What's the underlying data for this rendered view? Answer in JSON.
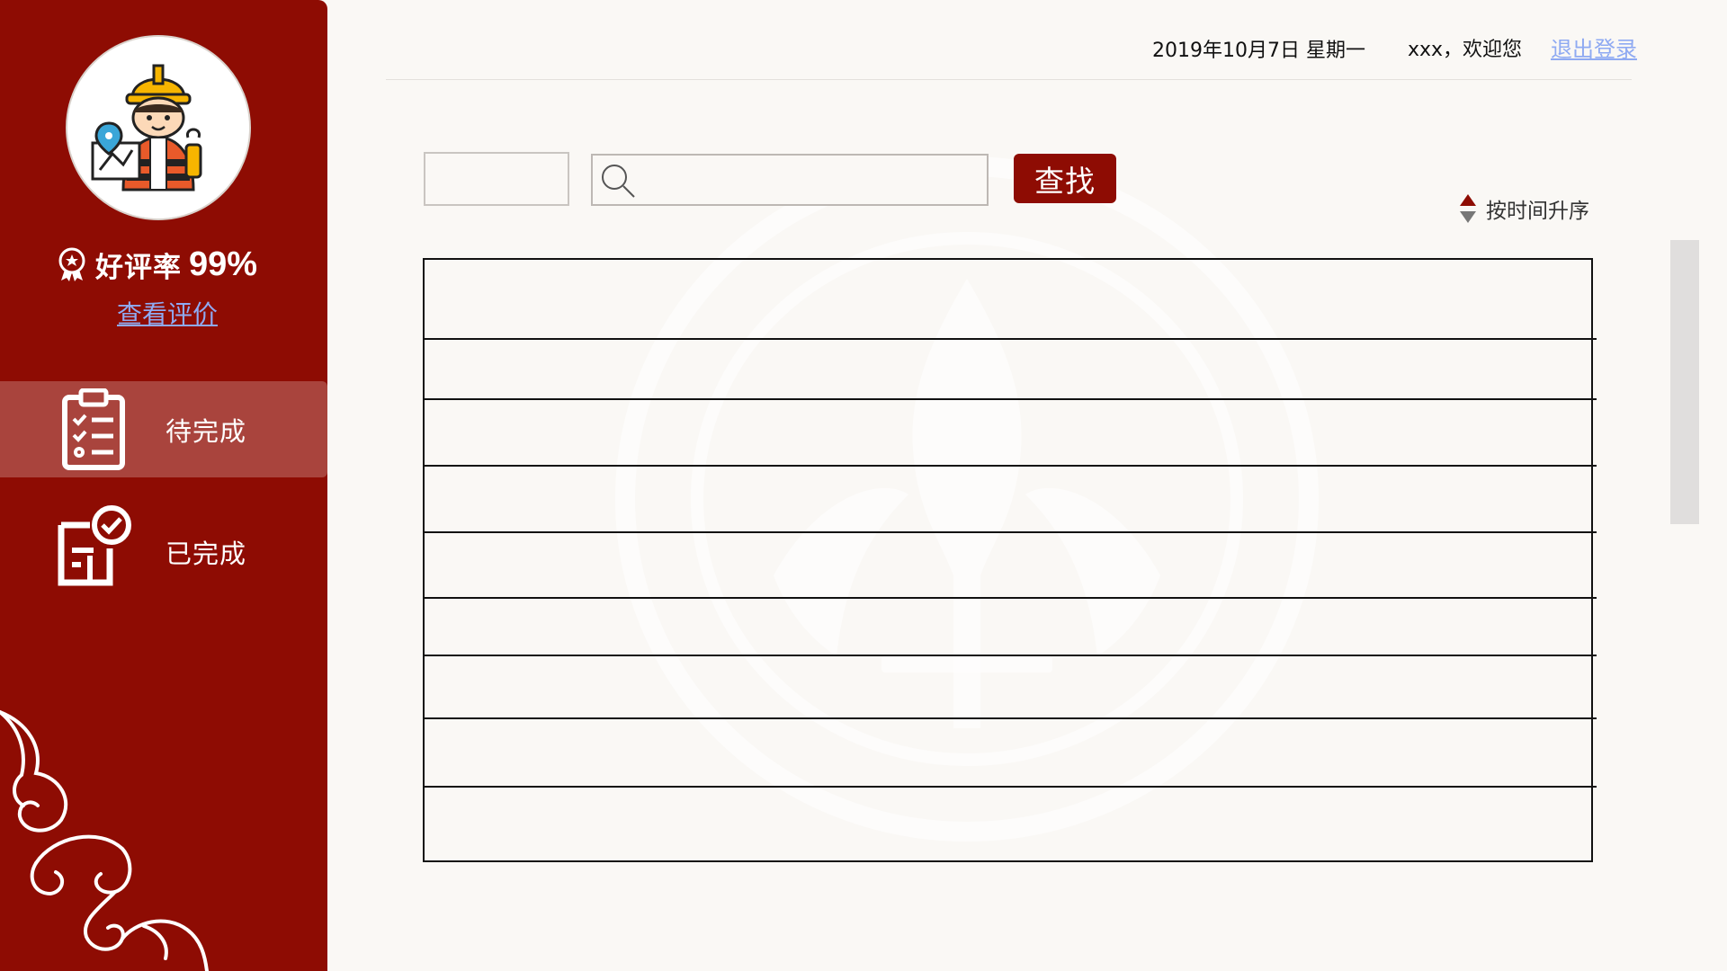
{
  "sidebar": {
    "rating_label": "好评率",
    "rating_value": "99%",
    "view_reviews": "查看评价",
    "nav": [
      {
        "label": "待完成",
        "active": true,
        "icon": "clipboard-checklist-icon"
      },
      {
        "label": "已完成",
        "active": false,
        "icon": "document-check-icon"
      }
    ]
  },
  "header": {
    "date": "2019年10月7日 星期一",
    "welcome": "xxx，欢迎您",
    "logout": "退出登录"
  },
  "search": {
    "filter_value": "",
    "input_value": "",
    "button_label": "查找"
  },
  "sort": {
    "label": "按时间升序"
  },
  "table": {
    "rows": [
      "",
      "",
      "",
      "",
      "",
      "",
      "",
      "",
      ""
    ]
  },
  "colors": {
    "brand_red": "#8e0c03",
    "active_nav": "#a9443d",
    "link_blue": "#8faaf2",
    "background": "#faf8f5"
  }
}
